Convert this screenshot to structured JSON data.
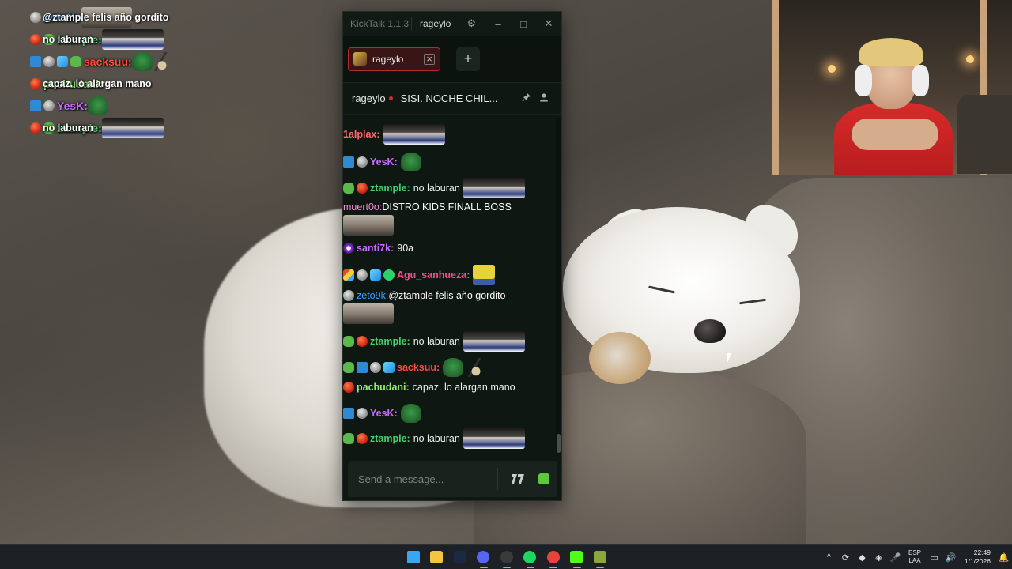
{
  "overlay_chat": [
    {
      "badges": [
        "b-gray"
      ],
      "user": "zeto9k",
      "user_color": "#3aa0ff",
      "text": "@ztample felis año gordito",
      "emote": "em-face2"
    },
    {
      "badges": [
        "b-red",
        "b-green"
      ],
      "user": "ztample",
      "user_color": "#44d16b",
      "text": "no laburan",
      "emote": "em-face"
    },
    {
      "badges": [
        "b-sword",
        "b-gray",
        "b-blue",
        "b-green"
      ],
      "user": "sacksuu",
      "user_color": "#ff4a3d",
      "text": "",
      "emote": "em-frog",
      "emote2": "em-chef"
    },
    {
      "badges": [
        "b-red"
      ],
      "user": "pachudani",
      "user_color": "#8df26a",
      "text": "capaz. lo alargan mano",
      "emote": ""
    },
    {
      "badges": [
        "b-sword",
        "b-gray"
      ],
      "user": "YesK",
      "user_color": "#c86bff",
      "text": "",
      "emote": "em-frog"
    },
    {
      "badges": [
        "b-red",
        "b-green"
      ],
      "user": "ztample",
      "user_color": "#44d16b",
      "text": "no laburan",
      "emote": "em-face"
    }
  ],
  "window": {
    "app_name": "KickTalk 1.1.3",
    "title_user": "rageylo",
    "settings_icon": "gear-icon",
    "minimize": "–",
    "maximize": "□",
    "close": "✕"
  },
  "tabs": {
    "active_label": "rageylo",
    "close_symbol": "×",
    "add_symbol": "+"
  },
  "channel": {
    "name": "rageylo",
    "title": "SISI. NOCHE CHIL...",
    "pin_icon": "pin-icon",
    "user_icon": "user-icon"
  },
  "messages": [
    {
      "badges": [],
      "user": "1alplax",
      "user_color": "#ff6b6b",
      "text": "",
      "emote": "em-face"
    },
    {
      "badges": [
        "b-sword",
        "b-gray"
      ],
      "user": "YesK",
      "user_color": "#c86bff",
      "text": "",
      "emote": "em-frog"
    },
    {
      "badges": [
        "b-green",
        "b-red"
      ],
      "user": "ztample",
      "user_color": "#44d16b",
      "text": "no laburan",
      "emote": "em-face"
    },
    {
      "badges": [],
      "user": "muert0o",
      "user_color": "#ff8ad8",
      "text": "DISTRO KIDS FINALL BOSS",
      "emote": "em-face2",
      "block": true
    },
    {
      "badges": [
        "b-purple"
      ],
      "user": "santi7k",
      "user_color": "#c86bff",
      "text": "90a",
      "emote": ""
    },
    {
      "badges": [
        "b-multi",
        "b-gray",
        "b-blue",
        "b-check"
      ],
      "user": "Agu_sanhueza",
      "user_color": "#ff4a8d",
      "text": "",
      "emote": "em-sponge"
    },
    {
      "badges": [
        "b-gray"
      ],
      "user": "zeto9k",
      "user_color": "#3aa0ff",
      "text": "@ztample felis año gordito",
      "emote": "em-face2",
      "block": true
    },
    {
      "badges": [
        "b-green",
        "b-red"
      ],
      "user": "ztample",
      "user_color": "#44d16b",
      "text": "no laburan",
      "emote": "em-face"
    },
    {
      "badges": [
        "b-green",
        "b-sword",
        "b-gray",
        "b-blue"
      ],
      "user": "sacksuu",
      "user_color": "#ff4a3d",
      "text": "",
      "emote": "em-frog",
      "emote2": "em-chef"
    },
    {
      "badges": [
        "b-red"
      ],
      "user": "pachudani",
      "user_color": "#8df26a",
      "text": "capaz. lo alargan mano",
      "emote": ""
    },
    {
      "badges": [
        "b-sword",
        "b-gray"
      ],
      "user": "YesK",
      "user_color": "#c86bff",
      "text": "",
      "emote": "em-frog"
    },
    {
      "badges": [
        "b-green",
        "b-red"
      ],
      "user": "ztample",
      "user_color": "#44d16b",
      "text": "no laburan",
      "emote": "em-face"
    }
  ],
  "input": {
    "placeholder": "Send a message...",
    "seventv_label": "7",
    "emote_icon": "emote-picker-icon"
  },
  "taskbar": {
    "apps": [
      "windows-start",
      "file-explorer",
      "steam",
      "discord",
      "obs",
      "spotify",
      "chrome",
      "kick",
      "kicktalk"
    ],
    "lang_top": "ESP",
    "lang_bottom": "LAA",
    "time": "22:49",
    "date": "1/1/2026"
  }
}
